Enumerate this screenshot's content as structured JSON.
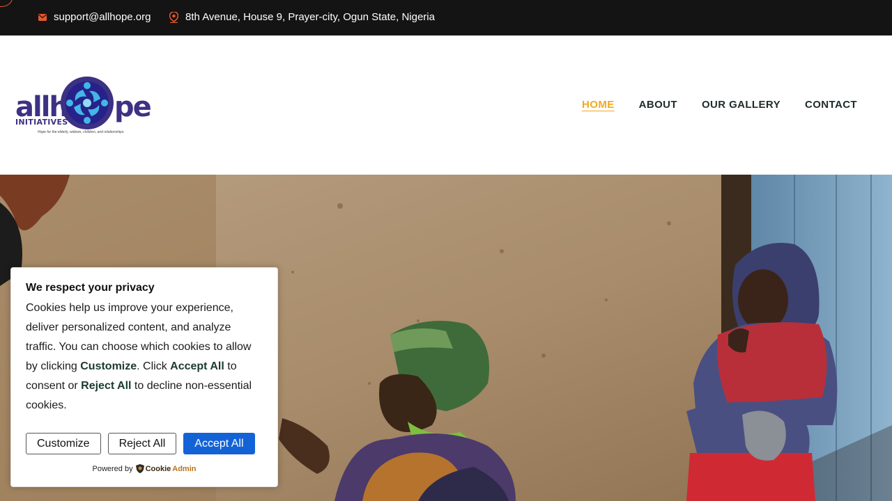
{
  "topbar": {
    "email": "support@allhope.org",
    "address": "8th Avenue, House 9, Prayer-city, Ogun State, Nigeria",
    "icon_color": "#e4572e"
  },
  "logo": {
    "word_left": "allh",
    "word_right": "pe",
    "subtitle": "INITIATIVES",
    "tagline": "Hope for the elderly, widows, children, and relationships."
  },
  "nav": {
    "items": [
      {
        "label": "HOME",
        "active": true
      },
      {
        "label": "ABOUT",
        "active": false
      },
      {
        "label": "OUR GALLERY",
        "active": false
      },
      {
        "label": "CONTACT",
        "active": false
      }
    ],
    "active_color": "#f2a81d"
  },
  "cookie": {
    "title": "We respect your privacy",
    "body_1": "Cookies help us improve your experience, deliver personalized content, and analyze traffic. You can choose which cookies to allow by clicking ",
    "body_customize": "Customize",
    "body_2": ". Click ",
    "body_accept": "Accept All",
    "body_3": " to consent or ",
    "body_reject": "Reject All",
    "body_4": " to decline non-essential cookies.",
    "buttons": {
      "customize": "Customize",
      "reject": "Reject All",
      "accept": "Accept All"
    },
    "powered_by": "Powered by",
    "brand_cookie": "Cookie",
    "brand_admin": "Admin",
    "accent": "#1463d6"
  }
}
